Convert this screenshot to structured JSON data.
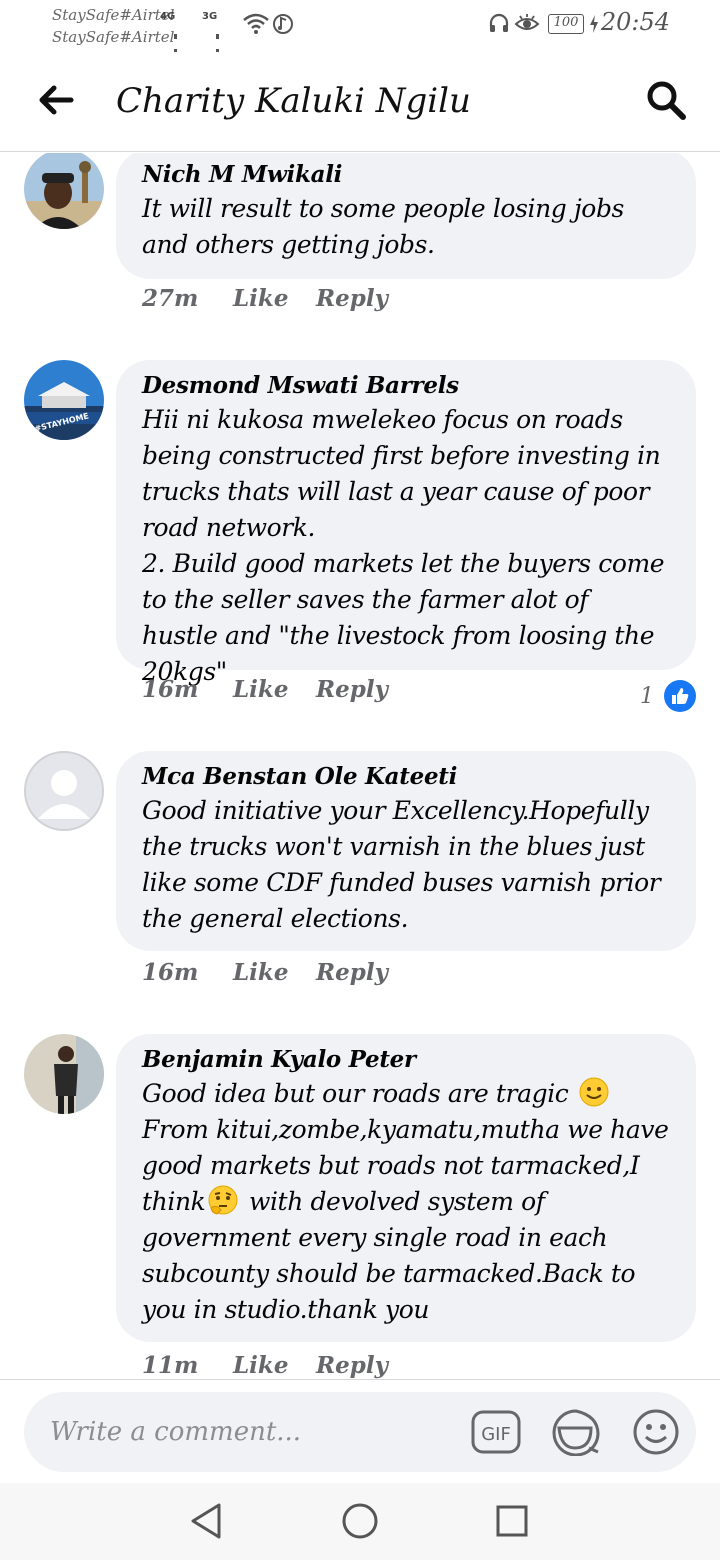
{
  "status_bar": {
    "carriers": [
      "StaySafe#Airtel",
      "StaySafe#Airtel"
    ],
    "network_tags": [
      "4G",
      "3G"
    ],
    "battery": "100",
    "time": "20:54"
  },
  "header": {
    "title": "Charity Kaluki Ngilu",
    "back_icon": "arrow-left-icon",
    "search_icon": "search-icon"
  },
  "comments": [
    {
      "author": "Nich M Mwikali",
      "text": "It will result to some people losing jobs and others getting jobs.",
      "time": "27m",
      "like_label": "Like",
      "reply_label": "Reply"
    },
    {
      "author": "Desmond Mswati Barrels",
      "text": "Hii ni kukosa mwelekeo focus on roads being constructed first before investing in trucks thats will last a year cause of poor road network.\n2. Build good markets let the buyers come to the seller saves the farmer alot of hustle and \"the livestock from loosing the 20kgs\"",
      "time": "16m",
      "like_label": "Like",
      "reply_label": "Reply",
      "avatar_badge": "#STAYHOME",
      "reaction_count": "1"
    },
    {
      "author": "Mca Benstan Ole Kateeti",
      "text": "Good initiative your Excellency.Hopefully the trucks won't varnish in the blues just like some CDF funded buses varnish prior the general elections.",
      "time": "16m",
      "like_label": "Like",
      "reply_label": "Reply"
    },
    {
      "author": "Benjamin Kyalo Peter",
      "text_parts": [
        "Good idea but our roads are tragic ",
        "\nFrom kitui,zombe,kyamatu,mutha we have good markets but roads not tarmacked,I think",
        " with devolved system of government every single road in each subcounty should be tarmacked.Back to you  in  studio.thank you"
      ],
      "time": "11m",
      "like_label": "Like",
      "reply_label": "Reply"
    }
  ],
  "composer": {
    "placeholder": "Write a comment...",
    "gif_label": "GIF"
  },
  "colors": {
    "bubble": "#f0f2f5",
    "meta_text": "#65676b",
    "like_blue": "#1877f2"
  }
}
